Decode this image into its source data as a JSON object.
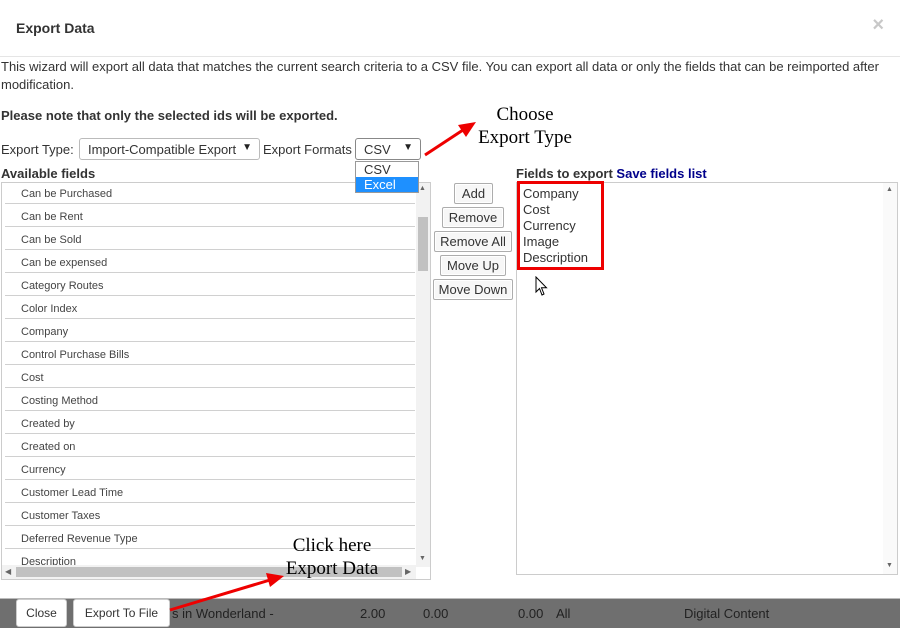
{
  "modal": {
    "title": "Export Data",
    "close_glyph": "×",
    "description": "This wizard will export all data that matches the current search criteria to a CSV file. You can export all data or only the fields that can be reimported after modification.",
    "note": "Please note that only the selected ids will be exported."
  },
  "export_type": {
    "label": "Export Type:",
    "value": "Import-Compatible Export"
  },
  "export_formats": {
    "label": "Export Formats",
    "value": "CSV",
    "options": [
      "CSV",
      "Excel"
    ],
    "highlighted": "Excel"
  },
  "available": {
    "title": "Available fields",
    "items": [
      "Can be Purchased",
      "Can be Rent",
      "Can be Sold",
      "Can be expensed",
      "Category Routes",
      "Color Index",
      "Company",
      "Control Purchase Bills",
      "Cost",
      "Costing Method",
      "Created by",
      "Created on",
      "Currency",
      "Customer Lead Time",
      "Customer Taxes",
      "Deferred Revenue Type",
      "Description"
    ]
  },
  "actions": {
    "add": "Add",
    "remove": "Remove",
    "remove_all": "Remove All",
    "move_up": "Move Up",
    "move_down": "Move Down"
  },
  "export_fields": {
    "title": "Fields to export",
    "save_link": "Save fields list",
    "items": [
      "Company",
      "Cost",
      "Currency",
      "Image",
      "Description"
    ]
  },
  "annotations": {
    "choose_line1": "Choose",
    "choose_line2": "Export Type",
    "click_line1": "Click here",
    "click_line2": "Export Data"
  },
  "footer": {
    "close": "Close",
    "export_to_file": "Export To File"
  },
  "background_row": {
    "name_fragment": "s in Wonderland -",
    "col1": "2.00",
    "col2": "0.00",
    "col3": "0.00",
    "col4": "All",
    "col5": "Digital Content"
  },
  "colors": {
    "highlight_box": "#ee0000",
    "arrow": "#ee0000",
    "dropdown_selected": "#1e90ff",
    "link": "#00008b"
  }
}
